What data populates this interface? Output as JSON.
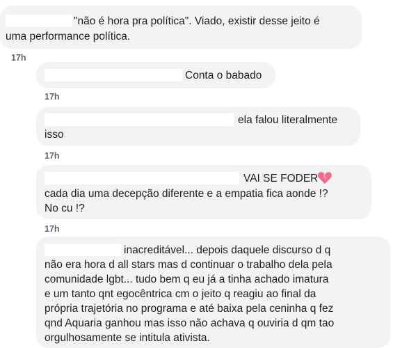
{
  "comments": [
    {
      "lines": [
        "\"não é hora pra política\". Viado, existir desse jeito é",
        "uma performance política."
      ],
      "time": "17h"
    },
    {
      "lines": [
        "Conta o babado"
      ],
      "time": "17h"
    },
    {
      "lines": [
        "ela falou literalmente",
        "isso"
      ],
      "time": "17h"
    },
    {
      "lines": [
        "VAI SE FODER",
        "cada dia uma decepção diferente e a empatia fica aonde !?",
        "No cu !?"
      ],
      "emoji_icon": "broken-heart-icon",
      "time": "17h"
    },
    {
      "lines": [
        "inacreditável... depois daquele discurso d q",
        "não era hora d all stars mas d continuar o trabalho dela pela",
        "comunidade lgbt... tudo bem q eu já a tinha achado imatura",
        "e um tanto qnt egocêntrica cm o jeito q reagiu ao final da",
        "própria trajetória no programa e até baixa pela ceninha q fez",
        "qnd Aquaria ganhou mas isso não achava q ouviria d qm tao",
        "orgulhosamente se intitula ativista."
      ]
    }
  ],
  "colors": {
    "bubble": "#f2f3f5",
    "text": "#1c1e21",
    "meta": "#606770",
    "emoji": "#f06b8a"
  }
}
